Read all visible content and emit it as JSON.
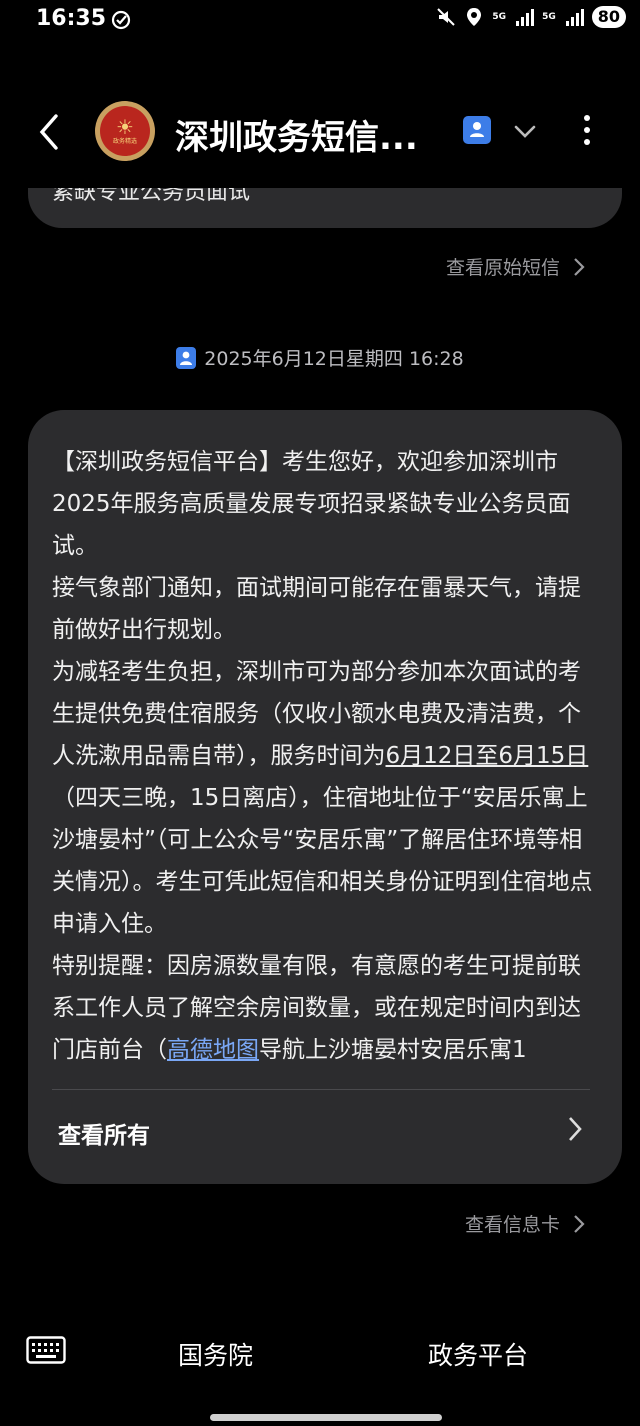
{
  "status_bar": {
    "time": "16:35",
    "network_1": "5G",
    "network_2": "5G",
    "battery": "80"
  },
  "header": {
    "title": "深圳政务短信...",
    "avatar_text": "政务精选"
  },
  "previous_message": {
    "fragment": "紧缺专业公务员面试",
    "view_original": "查看原始短信"
  },
  "message": {
    "date": "2025年6月12日星期四 16:28",
    "paragraphs": {
      "p1": "【深圳政务短信平台】考生您好，欢迎参加深圳市2025年服务高质量发展专项招录紧缺专业公务员面试。",
      "p2": "接气象部门通知，面试期间可能存在雷暴天气，请提前做好出行规划。",
      "p3_a": "为减轻考生负担，深圳市可为部分参加本次面试的考生提供免费住宿服务（仅收小额水电费及清洁费，个人洗漱用品需自带），服务时间为",
      "p3_date": "6月12日至6月15日",
      "p3_b": "（四天三晚，15日离店），住宿地址位于“安居乐寓上沙塘晏村”（可上公众号“安居乐寓”了解居住环境等相关情况）。考生可凭此短信和相关身份证明到住宿地点申请入住。",
      "p4_a": "特别提醒：因房源数量有限，有意愿的考生可提前联系工作人员了解空余房间数量，或在规定时间内到达门店前台（",
      "p4_link": "高德地图",
      "p4_b": "导航上沙塘晏村安居乐寓1"
    },
    "view_all": "查看所有",
    "view_card": "查看信息卡"
  },
  "bottom_menu": {
    "item_1": "国务院",
    "item_2": "政务平台"
  },
  "colors": {
    "accent": "#3d7de8",
    "bubble": "#2c2c2e",
    "link": "#7aa7f5"
  }
}
